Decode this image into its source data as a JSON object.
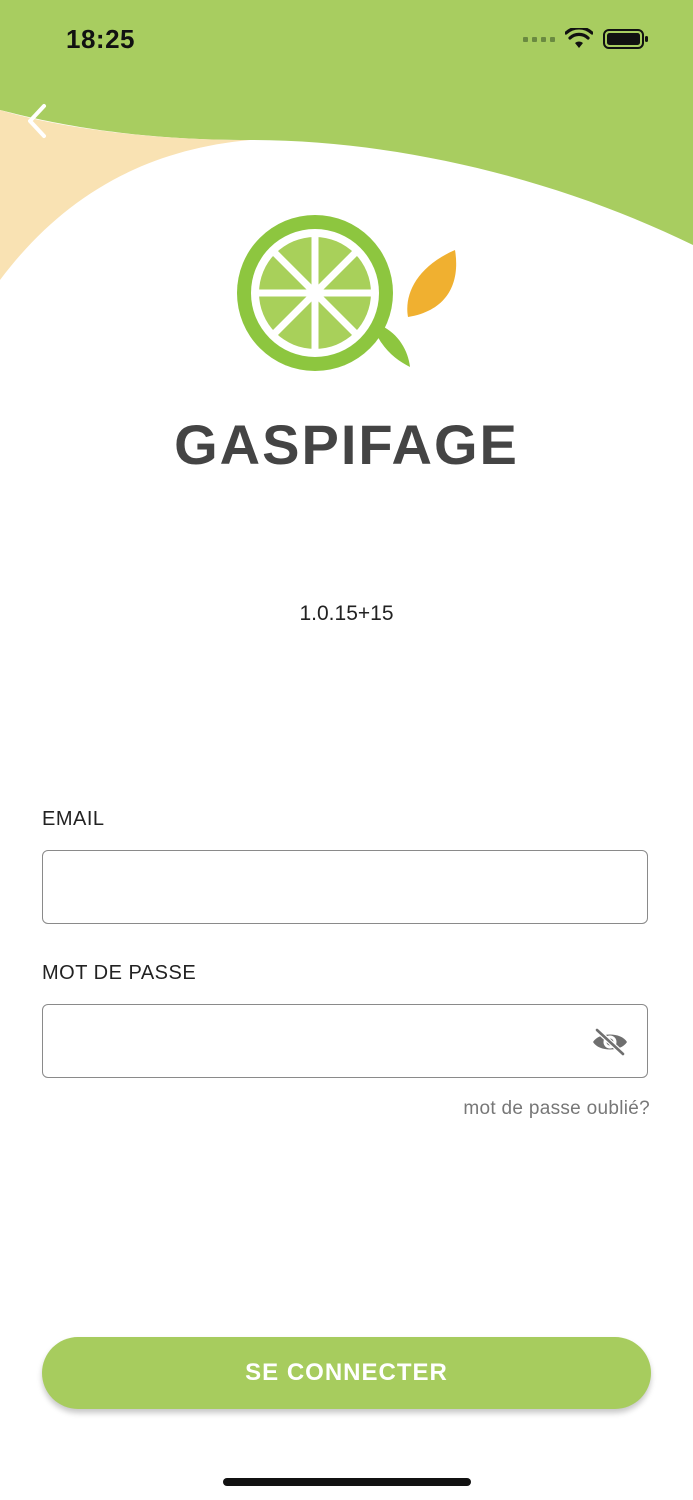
{
  "status_bar": {
    "time": "18:25",
    "icons": [
      "signal-icon",
      "wifi-icon",
      "battery-icon"
    ]
  },
  "header": {
    "back_icon": "chevron-left-icon"
  },
  "brand": {
    "name": "GASPIFAGE",
    "logo": "lime-slice-logo",
    "colors": {
      "lime": "#8dc63f",
      "leaf": "#f0b030",
      "text": "#444444"
    }
  },
  "app_version": "1.0.15+15",
  "form": {
    "email": {
      "label": "EMAIL",
      "value": "",
      "placeholder": ""
    },
    "password": {
      "label": "MOT DE PASSE",
      "value": "",
      "placeholder": "",
      "toggle_icon": "eye-off-icon"
    },
    "forgot_password": "mot de passe oublié?",
    "submit_label": "SE CONNECTER"
  },
  "theme": {
    "accent": "#a7cc5e",
    "header_green": "#a8cd60",
    "header_peach": "#f9e2b3"
  }
}
